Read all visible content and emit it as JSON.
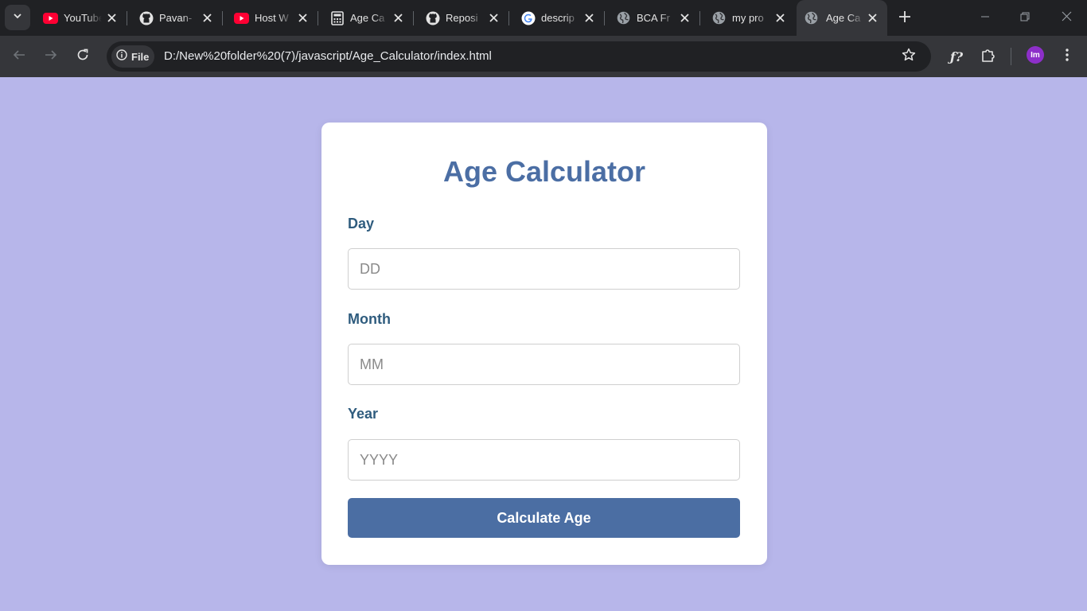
{
  "browser": {
    "tabs": [
      {
        "title": "YouTube",
        "icon": "youtube-icon"
      },
      {
        "title": "Pavan-",
        "icon": "github-icon"
      },
      {
        "title": "Host W",
        "icon": "youtube-icon"
      },
      {
        "title": "Age Ca",
        "icon": "calculator-icon"
      },
      {
        "title": "Reposi",
        "icon": "github-icon"
      },
      {
        "title": "descrip",
        "icon": "google-icon"
      },
      {
        "title": "BCA Fr",
        "icon": "globe-icon"
      },
      {
        "title": "my pro",
        "icon": "globe-icon"
      },
      {
        "title": "Age Ca",
        "icon": "globe-icon",
        "active": true
      }
    ],
    "address": {
      "chip_label": "File",
      "url": "D:/New%20folder%20(7)/javascript/Age_Calculator/index.html"
    },
    "profile_initials": "Im",
    "colors": {
      "accent_profile": "#8d2fc9",
      "youtube_red": "#ff0033"
    }
  },
  "page": {
    "title": "Age Calculator",
    "fields": [
      {
        "label": "Day",
        "placeholder": "DD",
        "value": ""
      },
      {
        "label": "Month",
        "placeholder": "MM",
        "value": ""
      },
      {
        "label": "Year",
        "placeholder": "YYYY",
        "value": ""
      }
    ],
    "button_label": "Calculate Age",
    "colors": {
      "background": "#b7b6ea",
      "title": "#4b6ea4",
      "label": "#2f5c7e",
      "button": "#4b6ea3"
    }
  }
}
